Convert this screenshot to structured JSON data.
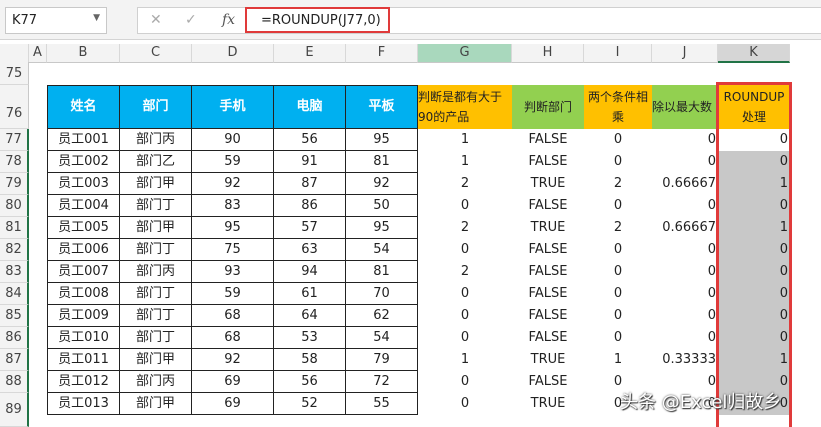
{
  "name_box": "K77",
  "formula": "=ROUNDUP(J77,0)",
  "columns": [
    "A",
    "B",
    "C",
    "D",
    "E",
    "F",
    "G",
    "H",
    "I",
    "J",
    "K"
  ],
  "row_numbers": [
    "75",
    "76",
    "77",
    "78",
    "79",
    "80",
    "81",
    "82",
    "83",
    "84",
    "85",
    "86",
    "87",
    "88",
    "89"
  ],
  "headers": [
    "姓名",
    "部门",
    "手机",
    "电脑",
    "平板",
    "判断是都有大于90的产品",
    "判断部门",
    "两个条件相乘",
    "除以最大数",
    "ROUNDUP处理"
  ],
  "rows": [
    [
      "员工001",
      "部门丙",
      "90",
      "56",
      "95",
      "1",
      "FALSE",
      "0",
      "0",
      "0"
    ],
    [
      "员工002",
      "部门乙",
      "59",
      "91",
      "81",
      "1",
      "FALSE",
      "0",
      "0",
      "0"
    ],
    [
      "员工003",
      "部门甲",
      "92",
      "87",
      "92",
      "2",
      "TRUE",
      "2",
      "0.66667",
      "1"
    ],
    [
      "员工004",
      "部门丁",
      "83",
      "86",
      "50",
      "0",
      "FALSE",
      "0",
      "0",
      "0"
    ],
    [
      "员工005",
      "部门甲",
      "95",
      "57",
      "95",
      "2",
      "TRUE",
      "2",
      "0.66667",
      "1"
    ],
    [
      "员工006",
      "部门丁",
      "75",
      "63",
      "54",
      "0",
      "FALSE",
      "0",
      "0",
      "0"
    ],
    [
      "员工007",
      "部门丙",
      "93",
      "94",
      "81",
      "2",
      "FALSE",
      "0",
      "0",
      "0"
    ],
    [
      "员工008",
      "部门丁",
      "59",
      "61",
      "70",
      "0",
      "FALSE",
      "0",
      "0",
      "0"
    ],
    [
      "员工009",
      "部门丁",
      "68",
      "64",
      "62",
      "0",
      "FALSE",
      "0",
      "0",
      "0"
    ],
    [
      "员工010",
      "部门丁",
      "68",
      "53",
      "54",
      "0",
      "FALSE",
      "0",
      "0",
      "0"
    ],
    [
      "员工011",
      "部门甲",
      "92",
      "58",
      "79",
      "1",
      "TRUE",
      "1",
      "0.33333",
      "1"
    ],
    [
      "员工012",
      "部门丙",
      "69",
      "56",
      "72",
      "0",
      "FALSE",
      "0",
      "0",
      "0"
    ],
    [
      "员工013",
      "部门甲",
      "69",
      "52",
      "55",
      "0",
      "TRUE",
      "0",
      "0",
      "0"
    ]
  ],
  "watermark": "头条 @Excel归故乡",
  "colors": {
    "blue": "#00b0f0",
    "orange": "#ffc000",
    "green": "#92d050",
    "highlight": "#e03a3a",
    "selected": "#c8c8c8"
  }
}
